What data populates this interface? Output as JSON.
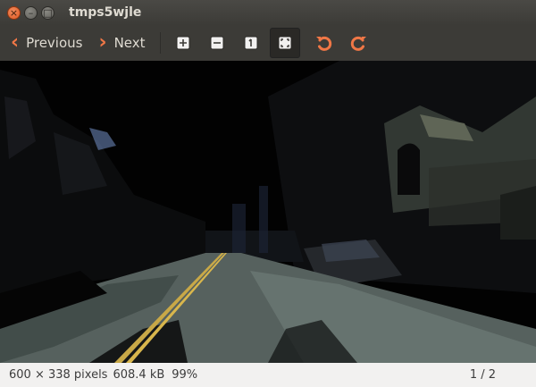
{
  "window": {
    "title": "tmps5wjle"
  },
  "toolbar": {
    "previous_label": "Previous",
    "next_label": "Next",
    "accent_color": "#f07746",
    "tools": [
      {
        "name": "zoom-in-icon"
      },
      {
        "name": "zoom-out-icon"
      },
      {
        "name": "normal-size-icon"
      },
      {
        "name": "best-fit-icon",
        "active": true
      },
      {
        "name": "rotate-left-icon"
      },
      {
        "name": "rotate-right-icon"
      }
    ]
  },
  "image": {
    "description_icon": "street-photo-cartoon-filter"
  },
  "status": {
    "dimensions": "600 × 338 pixels",
    "filesize": "608.4 kB",
    "zoom": "99%",
    "page": "1 / 2"
  }
}
